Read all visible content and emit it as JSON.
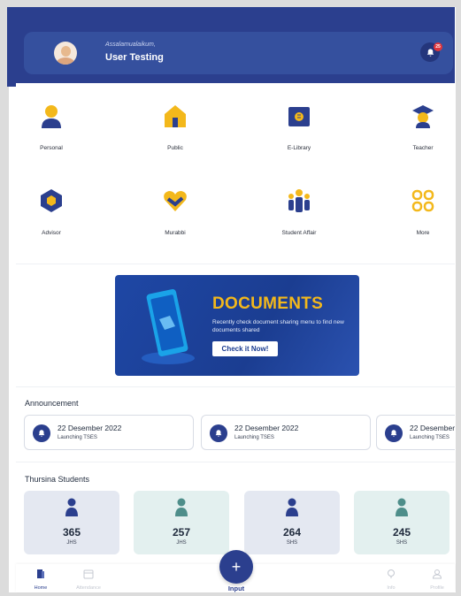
{
  "header": {
    "greeting": "Assalamualaikum,",
    "username": "User Testing",
    "notification_count": "25",
    "colors": {
      "primary": "#2b3f8e",
      "accent": "#f3b81b",
      "badge": "#e0343b"
    }
  },
  "menu": {
    "items": [
      {
        "label": "Personal",
        "icon": "person-icon"
      },
      {
        "label": "Public",
        "icon": "house-icon"
      },
      {
        "label": "E-Library",
        "icon": "book-icon"
      },
      {
        "label": "Teacher",
        "icon": "graduation-cap-icon"
      },
      {
        "label": "Advisor",
        "icon": "hexagon-icon"
      },
      {
        "label": "Murabbi",
        "icon": "heart-handshake-icon"
      },
      {
        "label": "Student Affair",
        "icon": "group-icon"
      },
      {
        "label": "More",
        "icon": "grid-icon"
      }
    ]
  },
  "banner": {
    "title": "DOCUMENTS",
    "subtitle": "Recently check document sharing menu to find new documents shared",
    "button_label": "Check it Now!"
  },
  "announcement": {
    "title": "Announcement",
    "items": [
      {
        "date": "22 Desember 2022",
        "description": "Launching TSES"
      },
      {
        "date": "22 Desember 2022",
        "description": "Launching TSES"
      },
      {
        "date": "22 Desember",
        "description": "Launching TSES"
      }
    ]
  },
  "students": {
    "title": "Thursina Students",
    "stats": [
      {
        "value": "365",
        "label": "JHS",
        "icon": "student-male-icon"
      },
      {
        "value": "257",
        "label": "JHS",
        "icon": "student-female-icon"
      },
      {
        "value": "264",
        "label": "SHS",
        "icon": "student-male-icon"
      },
      {
        "value": "245",
        "label": "SHS",
        "icon": "student-female-icon"
      }
    ]
  },
  "bottom_nav": {
    "items": [
      {
        "label": "Home",
        "icon": "home-icon"
      },
      {
        "label": "Attendance",
        "icon": "calendar-icon"
      },
      {
        "label": "Info",
        "icon": "bulb-icon"
      },
      {
        "label": "Profile",
        "icon": "user-icon"
      }
    ],
    "fab_label": "Input"
  }
}
